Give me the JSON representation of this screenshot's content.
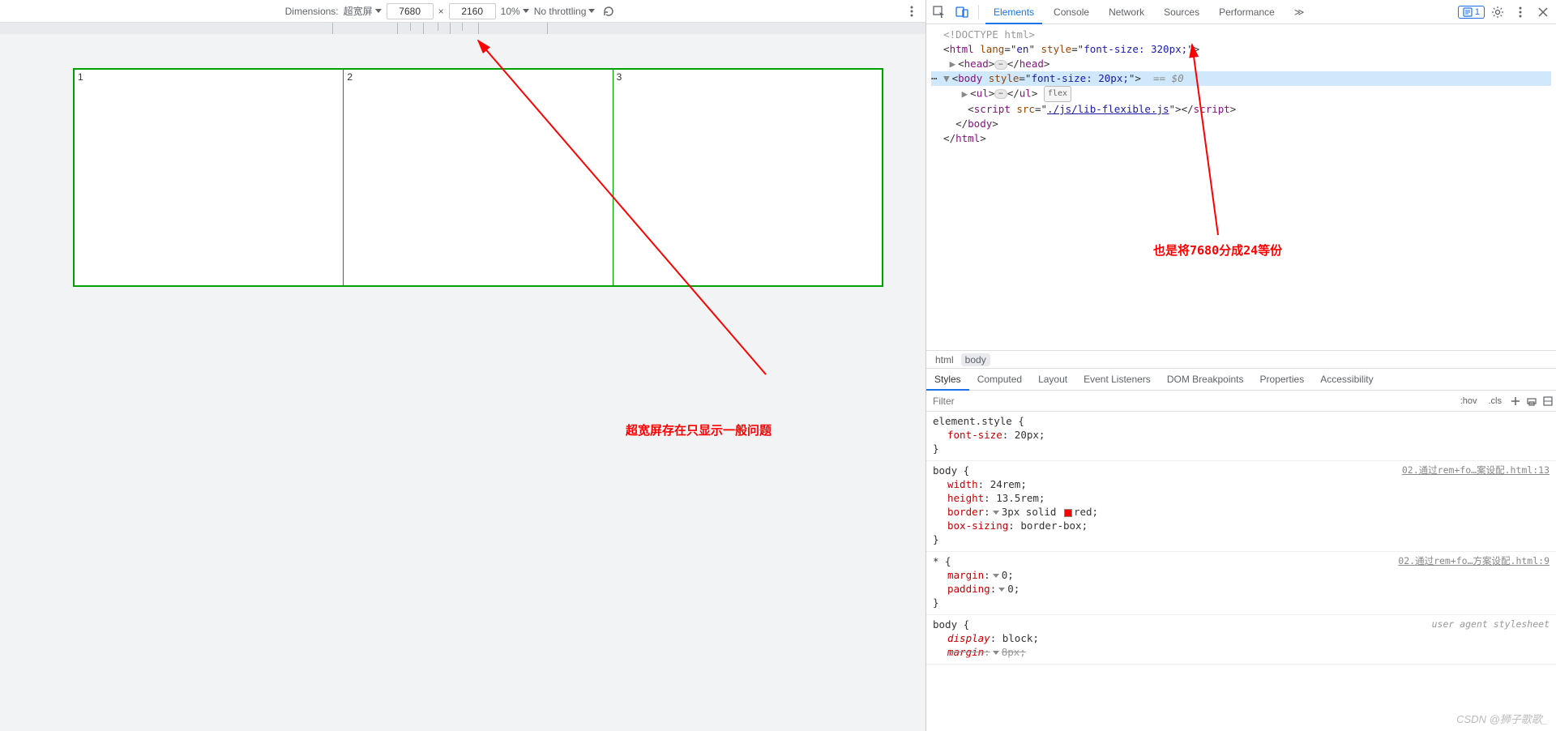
{
  "toolbar": {
    "dimensions_label": "Dimensions:",
    "device_name": "超宽屏",
    "width": "7680",
    "times": "×",
    "height": "2160",
    "zoom": "10%",
    "throttling": "No throttling"
  },
  "simulated": {
    "cells": [
      "1",
      "2",
      "3"
    ]
  },
  "annotations": {
    "left": "超宽屏存在只显示一般问题",
    "right": "也是将7680分成24等份"
  },
  "devtools": {
    "tabs": [
      "Elements",
      "Console",
      "Network",
      "Sources",
      "Performance"
    ],
    "more": "≫",
    "issues_count": "1"
  },
  "dom": {
    "doctype": "<!DOCTYPE html>",
    "html_open": "<html lang=\"en\" style=\"font-size: 320px;\">",
    "head": "<head>",
    "head_close": "</head>",
    "body_open": "<body style=\"font-size: 20px;\">",
    "eq0": "== $0",
    "ul": "<ul>",
    "ul_close": "</ul>",
    "flex": "flex",
    "script_open": "<script src=\"",
    "script_src": "./js/lib-flexible.js",
    "script_close": "\"></script>",
    "body_close": "</body>",
    "html_close": "</html>"
  },
  "breadcrumb": [
    "html",
    "body"
  ],
  "styles_tabs": [
    "Styles",
    "Computed",
    "Layout",
    "Event Listeners",
    "DOM Breakpoints",
    "Properties",
    "Accessibility"
  ],
  "filter": {
    "placeholder": "Filter",
    "hov": ":hov",
    "cls": ".cls"
  },
  "rules": {
    "r1": {
      "sel": "element.style {",
      "props": [
        [
          "font-size",
          "20px"
        ]
      ],
      "close": "}"
    },
    "r2": {
      "sel": "body {",
      "src": "02.通过rem+fo…案设配.html:13",
      "props": [
        [
          "width",
          "24rem"
        ],
        [
          "height",
          "13.5rem"
        ],
        [
          "border",
          "3px solid  red"
        ],
        [
          "box-sizing",
          "border-box"
        ]
      ],
      "close": "}"
    },
    "r3": {
      "sel": "* {",
      "src": "02.通过rem+fo…方案设配.html:9",
      "props": [
        [
          "margin",
          "0"
        ],
        [
          "padding",
          "0"
        ]
      ],
      "close": "}"
    },
    "r4": {
      "sel": "body {",
      "src": "user agent stylesheet",
      "props": [
        [
          "display",
          "block"
        ],
        [
          "margin",
          "8px"
        ]
      ],
      "close": ""
    }
  },
  "watermark": "CSDN @狮子歌歌_"
}
